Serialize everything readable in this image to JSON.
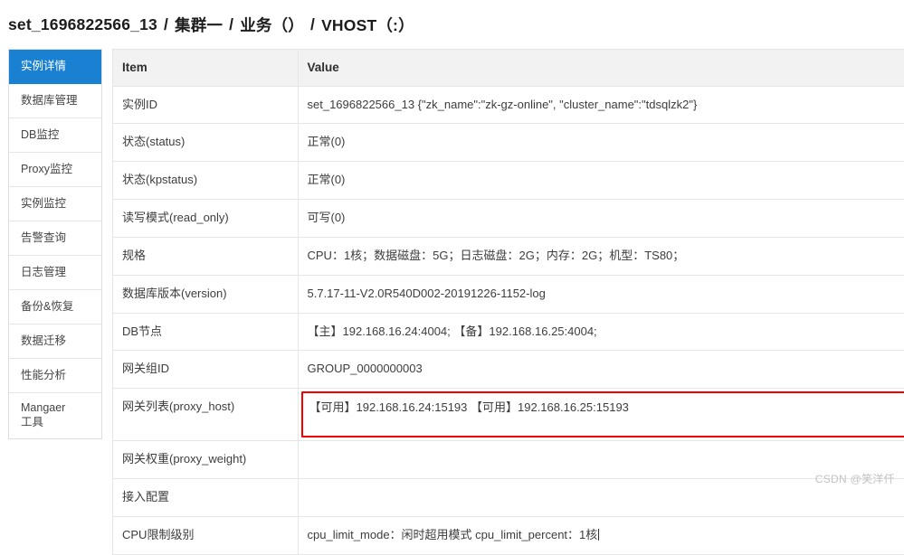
{
  "breadcrumb": {
    "separator": "/",
    "crumbs": [
      "set_1696822566_13",
      "集群一",
      "业务（）",
      "VHOST（:）"
    ]
  },
  "sidebar": {
    "items": [
      {
        "label": "实例详情",
        "active": true
      },
      {
        "label": "数据库管理",
        "active": false
      },
      {
        "label": "DB监控",
        "active": false
      },
      {
        "label": "Proxy监控",
        "active": false
      },
      {
        "label": "实例监控",
        "active": false
      },
      {
        "label": "告警查询",
        "active": false
      },
      {
        "label": "日志管理",
        "active": false
      },
      {
        "label": "备份&恢复",
        "active": false
      },
      {
        "label": "数据迁移",
        "active": false
      },
      {
        "label": "性能分析",
        "active": false
      },
      {
        "label": "Mangaer",
        "label2": "工具",
        "active": false
      }
    ]
  },
  "table": {
    "headers": {
      "item": "Item",
      "value": "Value"
    },
    "rows": [
      {
        "item": "实例ID",
        "value": "set_1696822566_13 {\"zk_name\":\"zk-gz-online\", \"cluster_name\":\"tdsqlzk2\"}",
        "tall": true
      },
      {
        "item": "状态(status)",
        "value": "正常(0)",
        "tall": false
      },
      {
        "item": "状态(kpstatus)",
        "value": "正常(0)",
        "tall": false
      },
      {
        "item": "读写模式(read_only)",
        "value": "可写(0)",
        "tall": true
      },
      {
        "item": "规格",
        "value": "CPU：1核；数据磁盘：5G；日志磁盘：2G；内存：2G；机型：TS80；",
        "tall": true
      },
      {
        "item": "数据库版本(version)",
        "value": "5.7.17-11-V2.0R540D002-20191226-1152-log",
        "tall": false
      },
      {
        "item": "DB节点",
        "value": "【主】192.168.16.24:4004;  【备】192.168.16.25:4004;",
        "tall": true
      },
      {
        "item": "网关组ID",
        "value": "GROUP_0000000003",
        "tall": false
      },
      {
        "item": "网关列表(proxy_host)",
        "value": "【可用】192.168.16.24:15193   【可用】192.168.16.25:15193",
        "tall": false,
        "highlight": true
      },
      {
        "item": "网关权重(proxy_weight)",
        "value": "",
        "tall": false
      },
      {
        "item": "接入配置",
        "value": "",
        "tall": true
      },
      {
        "item": "CPU限制级别",
        "value": "cpu_limit_mode：闲时超用模式  cpu_limit_percent：1核",
        "tall": true,
        "caret": true
      }
    ]
  },
  "watermark": {
    "text": "CSDN @笑洋仟"
  },
  "colors": {
    "accent": "#1a80d2",
    "highlight_border": "#f40000",
    "header_bg": "#f2f2f2",
    "border": "#e6e6e6"
  }
}
